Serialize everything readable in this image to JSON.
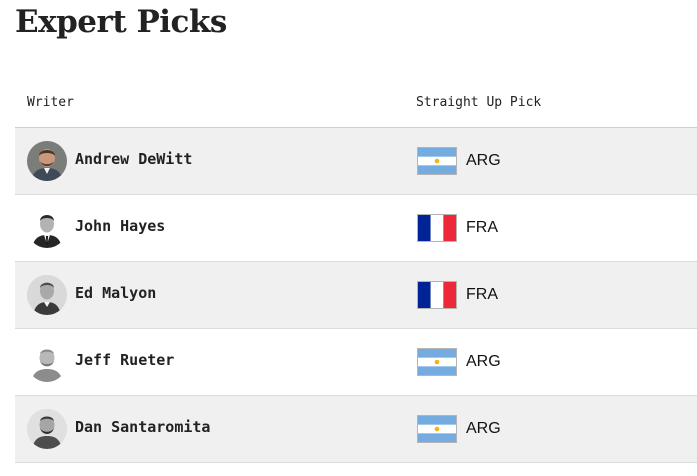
{
  "page": {
    "title": "Expert Picks"
  },
  "table": {
    "columns": {
      "writer": "Writer",
      "pick": "Straight Up Pick"
    },
    "rows": [
      {
        "writer": "Andrew DeWitt",
        "pick": "ARG",
        "flag_icon": "argentina-flag-icon"
      },
      {
        "writer": "John Hayes",
        "pick": "FRA",
        "flag_icon": "france-flag-icon"
      },
      {
        "writer": "Ed Malyon",
        "pick": "FRA",
        "flag_icon": "france-flag-icon"
      },
      {
        "writer": "Jeff Rueter",
        "pick": "ARG",
        "flag_icon": "argentina-flag-icon"
      },
      {
        "writer": "Dan Santaromita",
        "pick": "ARG",
        "flag_icon": "argentina-flag-icon"
      }
    ]
  },
  "colors": {
    "argentina_blue": "#74acdf",
    "argentina_sun": "#f6b40e",
    "france_blue": "#002395",
    "france_red": "#ed2939",
    "row_shade": "#f0f0f0"
  }
}
